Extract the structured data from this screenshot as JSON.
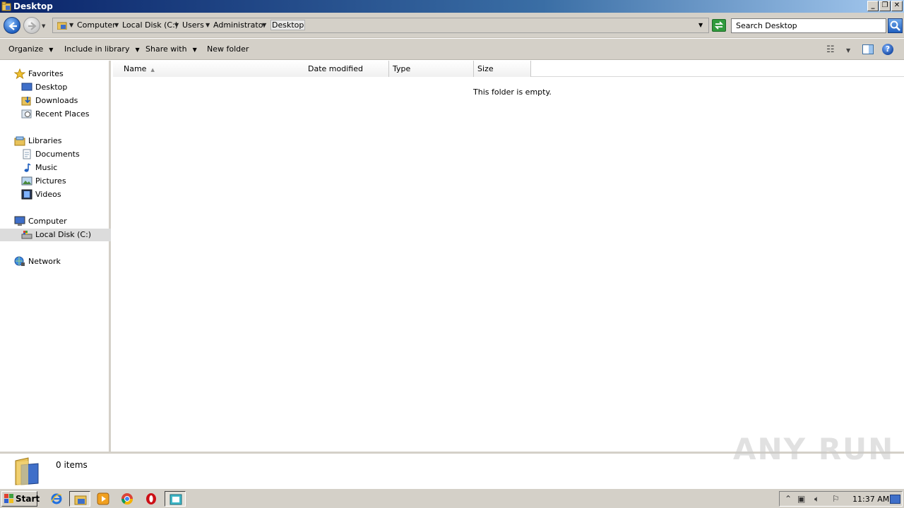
{
  "window": {
    "title": "Desktop"
  },
  "address": {
    "crumbs": [
      "Computer",
      "Local Disk (C:)",
      "Users",
      "Administrator"
    ],
    "current": "Desktop"
  },
  "search": {
    "value": "Search Desktop"
  },
  "toolbar": {
    "organize": "Organize",
    "include_in_library": "Include in library",
    "share_with": "Share with",
    "new_folder": "New folder"
  },
  "nav": {
    "favorites": "Favorites",
    "desktop": "Desktop",
    "downloads": "Downloads",
    "recent_places": "Recent Places",
    "libraries": "Libraries",
    "documents": "Documents",
    "music": "Music",
    "pictures": "Pictures",
    "videos": "Videos",
    "computer": "Computer",
    "local_disk": "Local Disk (C:)",
    "network": "Network"
  },
  "columns": {
    "name": "Name",
    "date_modified": "Date modified",
    "type": "Type",
    "size": "Size"
  },
  "content": {
    "empty_message": "This folder is empty."
  },
  "details": {
    "item_count": "0 items"
  },
  "watermark": "ANY RUN",
  "taskbar": {
    "start": "Start",
    "clock": "11:37 AM"
  },
  "colors": {
    "title_start": "#0a246a",
    "title_end": "#a6caf0",
    "chrome": "#d4d0c8"
  }
}
